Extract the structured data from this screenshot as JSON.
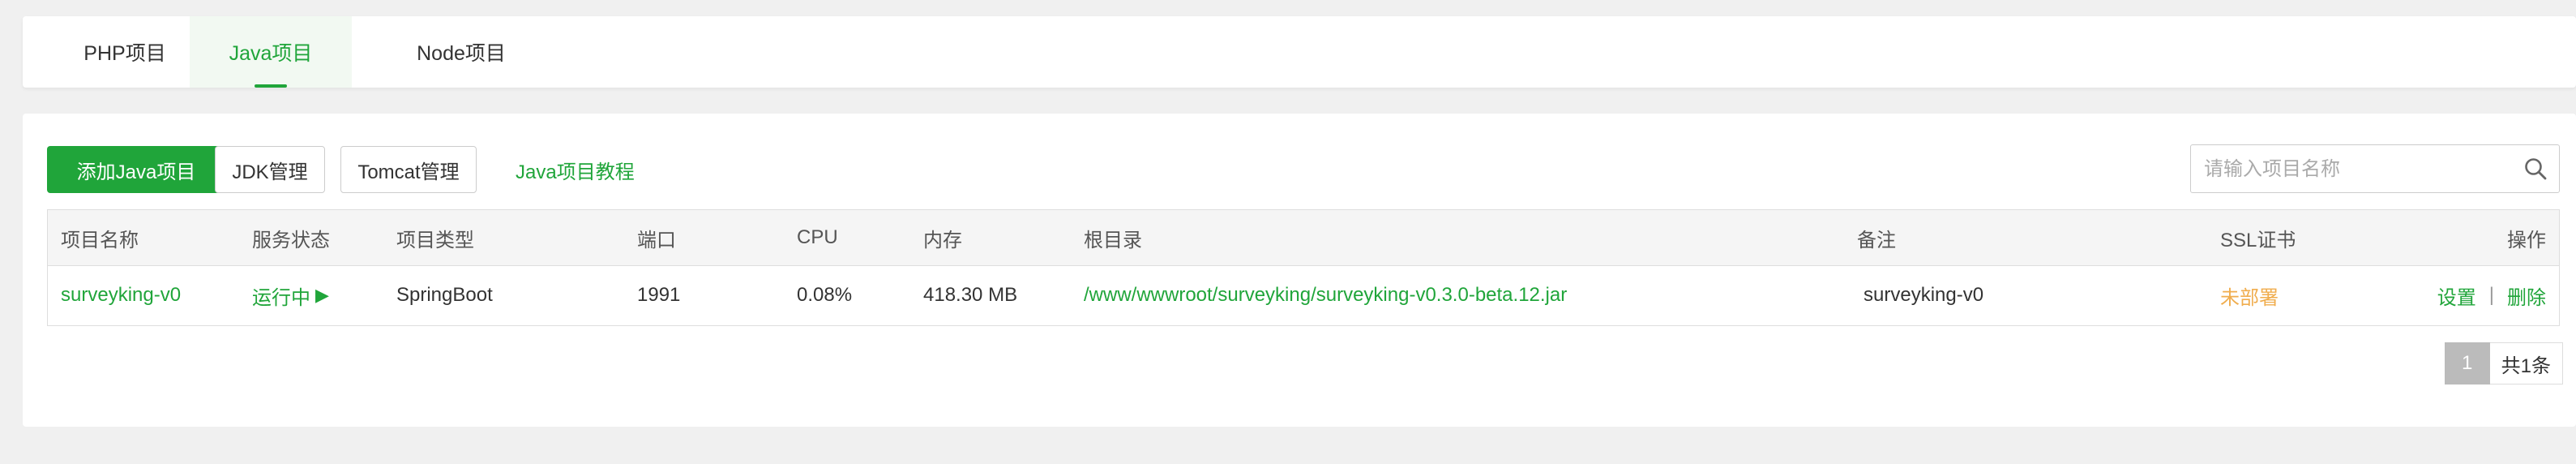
{
  "tabs": [
    {
      "label": "PHP项目"
    },
    {
      "label": "Java项目"
    },
    {
      "label": "Node项目"
    }
  ],
  "toolbar": {
    "add_label": "添加Java项目",
    "jdk_label": "JDK管理",
    "tomcat_label": "Tomcat管理",
    "tutorial_label": "Java项目教程"
  },
  "search": {
    "placeholder": "请输入项目名称",
    "value": ""
  },
  "table": {
    "columns": [
      "项目名称",
      "服务状态",
      "项目类型",
      "端口",
      "CPU",
      "内存",
      "根目录",
      "备注",
      "SSL证书",
      "操作"
    ],
    "rows": [
      {
        "name": "surveyking-v0",
        "status": "运行中",
        "type": "SpringBoot",
        "port": "1991",
        "cpu": "0.08%",
        "memory": "418.30 MB",
        "root": "/www/wwwroot/surveyking/surveyking-v0.3.0-beta.12.jar",
        "note": "surveyking-v0",
        "ssl": "未部署",
        "op_settings": "设置",
        "op_separator": "|",
        "op_delete": "删除"
      }
    ]
  },
  "pagination": {
    "current": "1",
    "total_label": "共1条"
  },
  "colors": {
    "accent": "#20a53a",
    "warning": "#f0ad4e"
  },
  "icons": {
    "search": "search-icon",
    "status": "play-icon"
  }
}
